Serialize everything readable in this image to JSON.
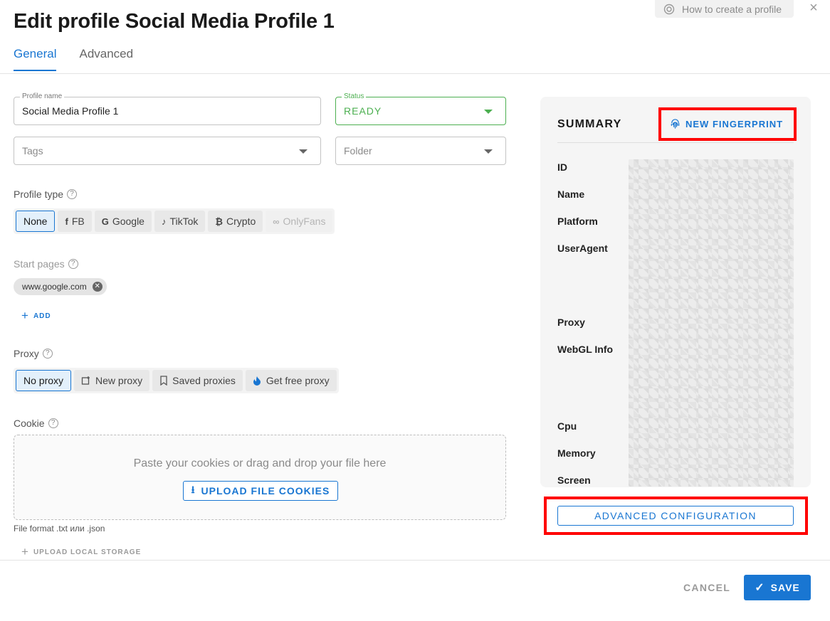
{
  "header": {
    "title": "Edit profile Social Media Profile 1",
    "help_label": "How to create a profile",
    "close_glyph": "×"
  },
  "tabs": [
    {
      "label": "General",
      "active": true
    },
    {
      "label": "Advanced",
      "active": false
    }
  ],
  "form": {
    "profile_name": {
      "legend": "Profile name",
      "value": "Social Media Profile 1"
    },
    "status": {
      "legend": "Status",
      "value": "READY"
    },
    "tags": {
      "placeholder": "Tags"
    },
    "folder": {
      "placeholder": "Folder"
    },
    "profile_type": {
      "label": "Profile type",
      "options": [
        {
          "label": "None",
          "icon": "",
          "active": true,
          "disabled": false
        },
        {
          "label": "FB",
          "icon": "facebook-icon",
          "active": false,
          "disabled": false
        },
        {
          "label": "Google",
          "icon": "google-icon",
          "active": false,
          "disabled": false
        },
        {
          "label": "TikTok",
          "icon": "tiktok-icon",
          "active": false,
          "disabled": false
        },
        {
          "label": "Crypto",
          "icon": "bitcoin-icon",
          "active": false,
          "disabled": false
        },
        {
          "label": "OnlyFans",
          "icon": "onlyfans-icon",
          "active": false,
          "disabled": true
        }
      ]
    },
    "start_pages": {
      "label": "Start pages",
      "chips": [
        "www.google.com"
      ],
      "add_label": "ADD"
    },
    "proxy": {
      "label": "Proxy",
      "options": [
        {
          "label": "No proxy",
          "icon": "",
          "active": true
        },
        {
          "label": "New proxy",
          "icon": "new-window-icon",
          "active": false
        },
        {
          "label": "Saved proxies",
          "icon": "bookmark-icon",
          "active": false
        },
        {
          "label": "Get free proxy",
          "icon": "flame-icon",
          "active": false
        }
      ]
    },
    "cookie": {
      "label": "Cookie",
      "drop_hint": "Paste your cookies or drag and drop your file here",
      "upload_label": "UPLOAD FILE COOKIES",
      "file_format": "File format .txt или .json",
      "upload_local_label": "UPLOAD LOCAL STORAGE"
    }
  },
  "summary": {
    "title": "SUMMARY",
    "new_fingerprint_label": "NEW FINGERPRINT",
    "keys": [
      "ID",
      "Name",
      "Platform",
      "UserAgent",
      "Proxy",
      "WebGL Info",
      "Cpu",
      "Memory",
      "Screen"
    ],
    "advanced_label": "ADVANCED CONFIGURATION"
  },
  "footer": {
    "cancel_label": "CANCEL",
    "save_label": "SAVE"
  },
  "colors": {
    "accent": "#1976d2",
    "ready": "#4caf50",
    "highlight": "#ff0000"
  }
}
